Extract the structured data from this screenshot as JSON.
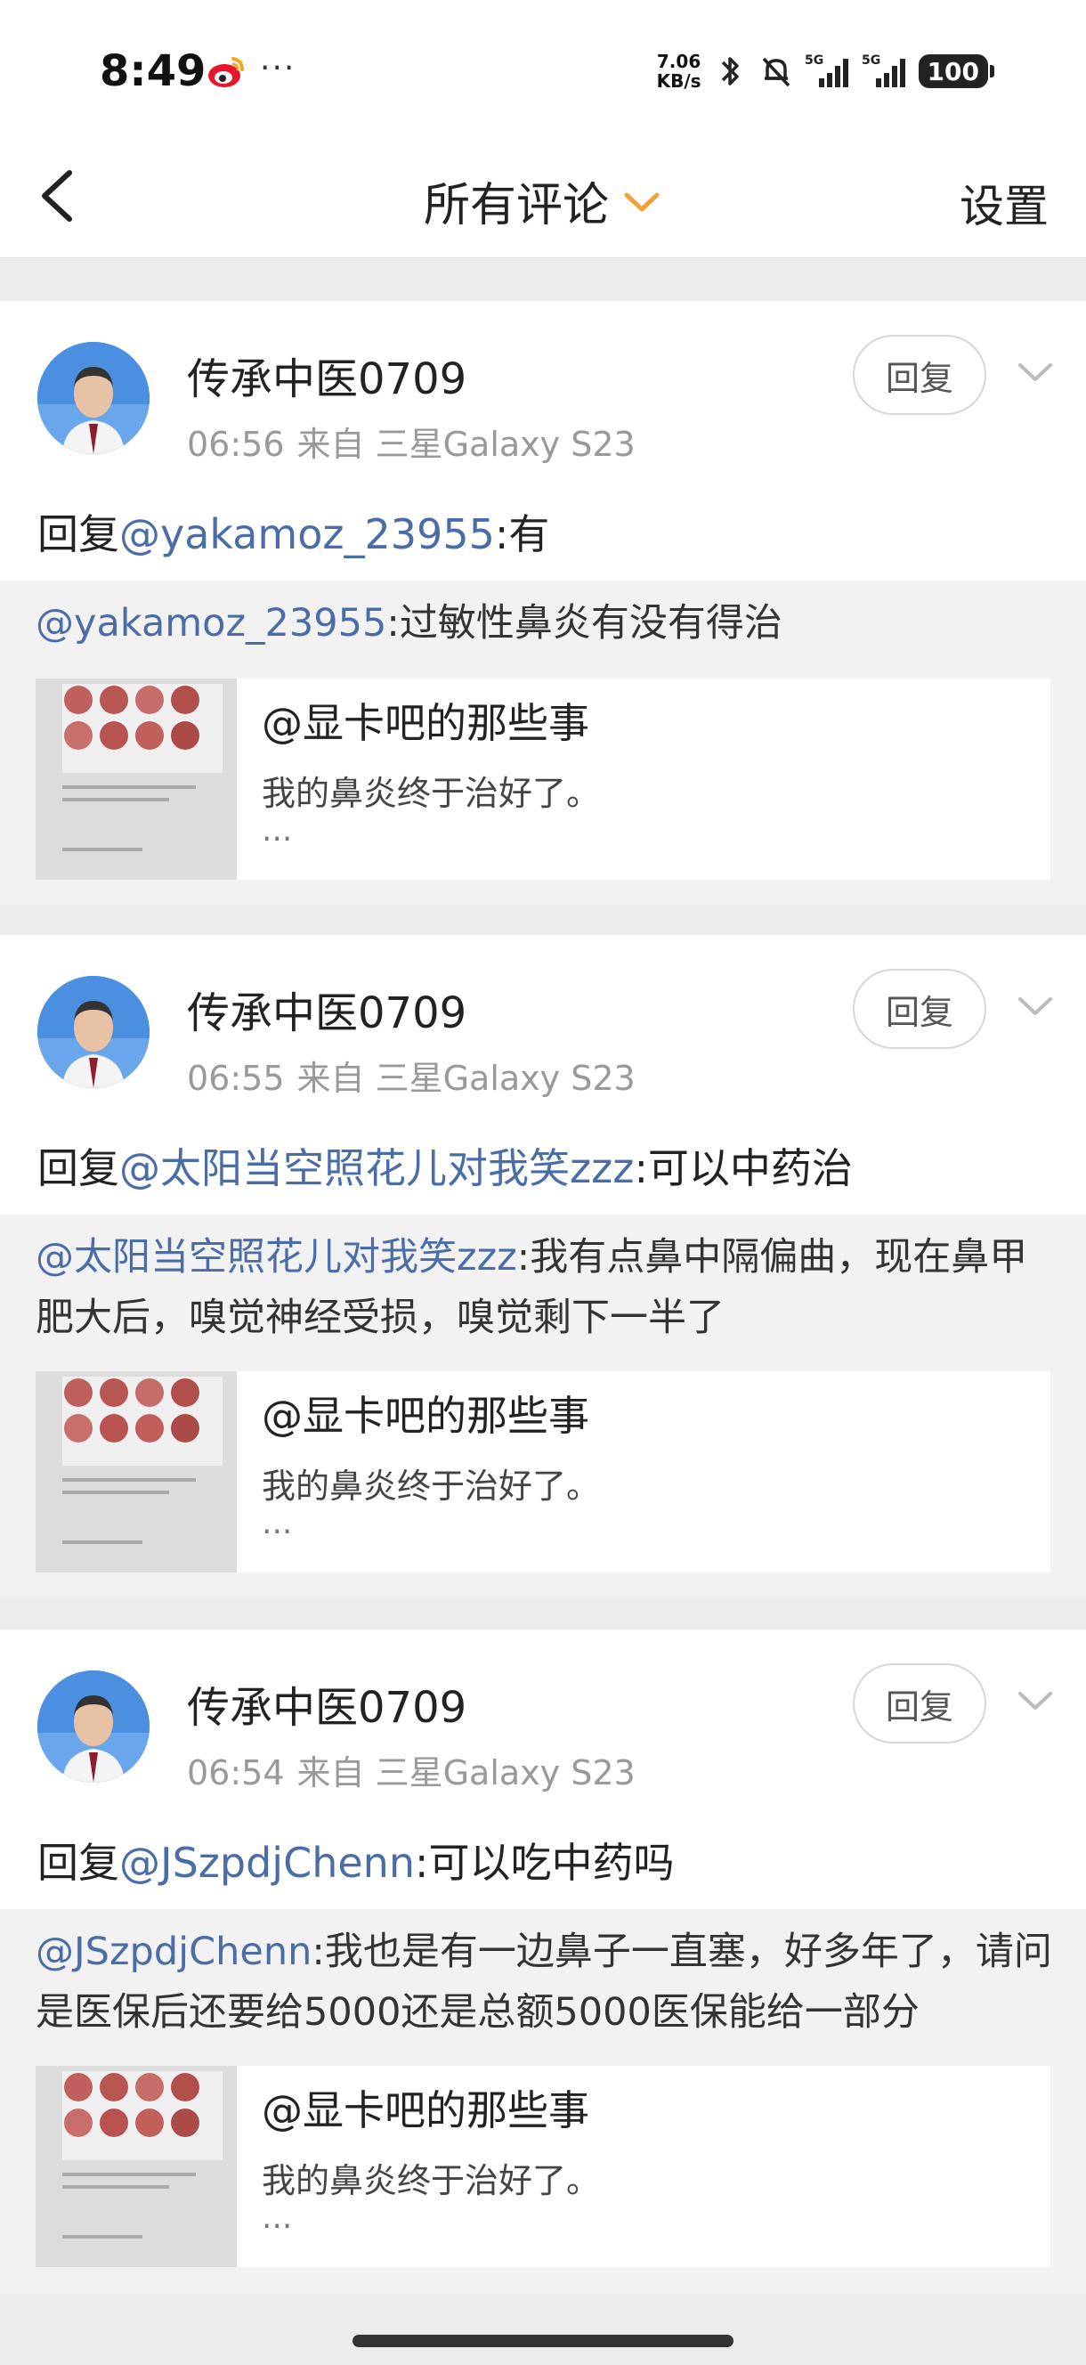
{
  "status_bar": {
    "time": "8:49",
    "notif_dots": "···",
    "net_speed_value": "7.06",
    "net_speed_unit": "KB/s",
    "sim1_label": "5G",
    "sim2_label": "5G",
    "battery_level": "100",
    "icons": [
      "weibo-icon",
      "bluetooth-icon",
      "mute-bell-icon",
      "signal-icon",
      "signal-icon",
      "battery-icon"
    ]
  },
  "header": {
    "title": "所有评论",
    "settings_label": "设置",
    "accent_color": "#f0a33a"
  },
  "comments": [
    {
      "username": "传承中医0709",
      "time": "06:56",
      "source": "来自 三星Galaxy S23",
      "reply_label": "回复",
      "reply_prefix": "回复",
      "mention": "@yakamoz_23955",
      "reply_text": ":有",
      "quoted_mention": "@yakamoz_23955",
      "quoted_text": ":过敏性鼻炎有没有得治",
      "link_title": "@显卡吧的那些事",
      "link_desc": "我的鼻炎终于治好了。",
      "link_more": "..."
    },
    {
      "username": "传承中医0709",
      "time": "06:55",
      "source": "来自 三星Galaxy S23",
      "reply_label": "回复",
      "reply_prefix": "回复",
      "mention": "@太阳当空照花儿对我笑zzz",
      "reply_text": ":可以中药治",
      "quoted_mention": "@太阳当空照花儿对我笑zzz",
      "quoted_text": ":我有点鼻中隔偏曲，现在鼻甲肥大后，嗅觉神经受损，嗅觉剩下一半了",
      "link_title": "@显卡吧的那些事",
      "link_desc": "我的鼻炎终于治好了。",
      "link_more": "..."
    },
    {
      "username": "传承中医0709",
      "time": "06:54",
      "source": "来自 三星Galaxy S23",
      "reply_label": "回复",
      "reply_prefix": "回复",
      "mention": "@JSzpdjChenn",
      "reply_text": ":可以吃中药吗",
      "quoted_mention": "@JSzpdjChenn",
      "quoted_text": ":我也是有一边鼻子一直塞，好多年了，请问是医保后还要给5000还是总额5000医保能给一部分",
      "link_title": "@显卡吧的那些事",
      "link_desc": "我的鼻炎终于治好了。",
      "link_more": "..."
    }
  ],
  "colors": {
    "mention": "#4a6da7",
    "meta": "#999999",
    "background": "#ebebeb"
  }
}
